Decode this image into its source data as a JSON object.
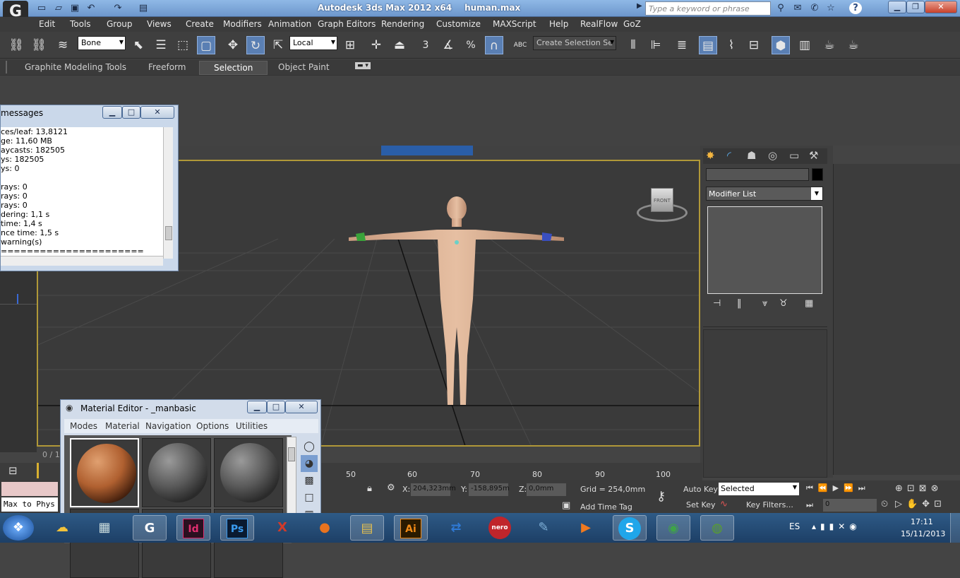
{
  "app": {
    "title": "Autodesk 3ds Max  2012 x64",
    "file": "human.max",
    "search_placeholder": "Type a keyword or phrase",
    "help_label": "?"
  },
  "menu": [
    "Edit",
    "Tools",
    "Group",
    "Views",
    "Create",
    "Modifiers",
    "Animation",
    "Graph Editors",
    "Rendering",
    "Customize",
    "MAXScript",
    "Help",
    "RealFlow",
    "GoZ"
  ],
  "toolbar": {
    "selection_filter": "Bone",
    "ref_coord": "Local",
    "named_selection_placeholder": "Create Selection Se",
    "snap_label": "3",
    "snap_percent": "%",
    "abc_label": "ABC"
  },
  "ribbon": {
    "tabs": [
      "Graphite Modeling Tools",
      "Freeform",
      "Selection",
      "Object Paint"
    ],
    "active_tab": "Selection"
  },
  "messages_window": {
    "title": "messages",
    "lines": [
      "ces/leaf: 13,8121",
      "ge: 11,60 MB",
      "aycasts: 182505",
      "ys: 182505",
      "ys: 0",
      "",
      "rays: 0",
      "rays: 0",
      "rays: 0",
      "dering: 1,1 s",
      "time: 1,4 s",
      "nce time: 1,5 s",
      "warning(s)",
      "======================"
    ]
  },
  "viewport": {
    "viewcube_label": "FRONT"
  },
  "command_panel": {
    "modifier_list": "Modifier List"
  },
  "material_editor": {
    "title": "Material Editor - _manbasic",
    "menu": [
      "Modes",
      "Material",
      "Navigation",
      "Options",
      "Utilities"
    ]
  },
  "timeline": {
    "ticks": [
      "50",
      "60",
      "70",
      "80",
      "90",
      "100"
    ],
    "frame_display": "0 / 1"
  },
  "status": {
    "maxscript_text": "Max to Phys",
    "x_label": "X:",
    "x_value": "204,323mm",
    "y_label": "Y:",
    "y_value": "-158,895m",
    "z_label": "Z:",
    "z_value": "0,0mm",
    "grid": "Grid = 254,0mm",
    "add_time_tag": "Add Time Tag",
    "auto_key": "Auto Key",
    "set_key": "Set Key",
    "key_mode": "Selected",
    "key_filters": "Key Filters...",
    "current_frame": "0"
  },
  "taskbar": {
    "apps": [
      {
        "name": "windows-start",
        "glyph": "❖",
        "color": "#3d7be0"
      },
      {
        "name": "yellow-app",
        "glyph": "☁",
        "color": "#f2c23a"
      },
      {
        "name": "calculator",
        "glyph": "▦",
        "color": "#9ab"
      },
      {
        "name": "3ds-max",
        "glyph": "G",
        "color": "#5a6a7a"
      },
      {
        "name": "indesign",
        "glyph": "Id",
        "color": "#e02e6f"
      },
      {
        "name": "photoshop",
        "glyph": "Ps",
        "color": "#1f5fa8"
      },
      {
        "name": "crossx",
        "glyph": "X",
        "color": "#d23a2a"
      },
      {
        "name": "firefox",
        "glyph": "●",
        "color": "#e8731f"
      },
      {
        "name": "explorer",
        "glyph": "▤",
        "color": "#e6c04f"
      },
      {
        "name": "illustrator",
        "glyph": "Ai",
        "color": "#f08a16"
      },
      {
        "name": "teamviewer",
        "glyph": "⇄",
        "color": "#2f7ad6"
      },
      {
        "name": "nero",
        "glyph": "nero",
        "color": "#c0252b"
      },
      {
        "name": "notepad",
        "glyph": "✎",
        "color": "#7fb0d8"
      },
      {
        "name": "media",
        "glyph": "▶",
        "color": "#f07a20"
      },
      {
        "name": "skype",
        "glyph": "S",
        "color": "#1fa6ea"
      },
      {
        "name": "chrome",
        "glyph": "◉",
        "color": "#3fa24a"
      },
      {
        "name": "globe-app",
        "glyph": "◍",
        "color": "#5aa02a"
      }
    ],
    "lang": "ES",
    "time": "17:11",
    "date": "15/11/2013"
  }
}
